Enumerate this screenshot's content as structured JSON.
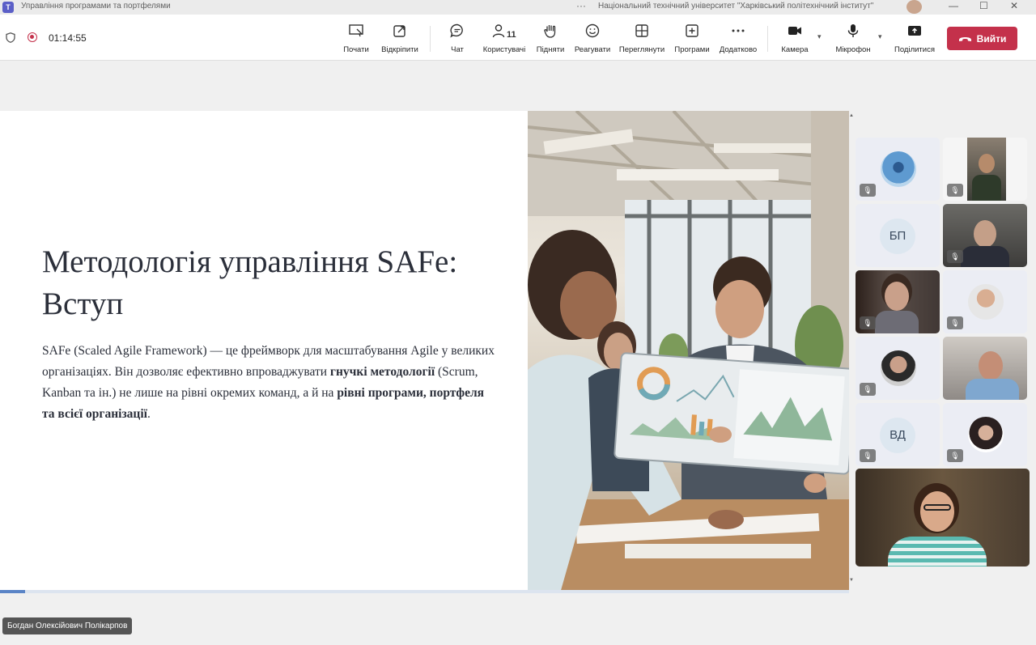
{
  "window": {
    "title": "Управління програмами та портфелями",
    "organization": "Національний технічний університет \"Харківський політехнічний інститут\"",
    "more_dots": "···",
    "app_logo_text": "T"
  },
  "toolbar": {
    "timer": "01:14:55",
    "buttons": {
      "start": "Почати",
      "popout": "Відкріпити",
      "chat": "Чат",
      "people": "Користувачі",
      "people_count": "11",
      "raise": "Підняти",
      "react": "Реагувати",
      "view": "Переглянути",
      "apps": "Програми",
      "more": "Додатково",
      "camera": "Камера",
      "mic": "Мікрофон",
      "share": "Поділитися",
      "leave": "Вийти"
    }
  },
  "slide": {
    "title": "Методологія управління SAFe: Вступ",
    "paragraph": {
      "p1": "SAFe (Scaled Agile Framework) — це фреймворк для масштабування Agile у великих організаціях. Він дозволяє ефективно впроваджувати ",
      "b1": "гнучкі методології",
      "p2": " (Scrum, Kanban та ін.) не лише на рівні окремих команд, а й на ",
      "b2": "рівні програми, портфеля та всієї організації",
      "p3": "."
    },
    "progress_fraction": 0.03
  },
  "participants": {
    "bp_initials": "БП",
    "vd_initials": "ВД"
  },
  "presenter_name": "Богдан Олексійович Полікарпов",
  "colors": {
    "leave": "#c4314b",
    "accent": "#5b5fc7",
    "progress": "#5a84c6"
  }
}
